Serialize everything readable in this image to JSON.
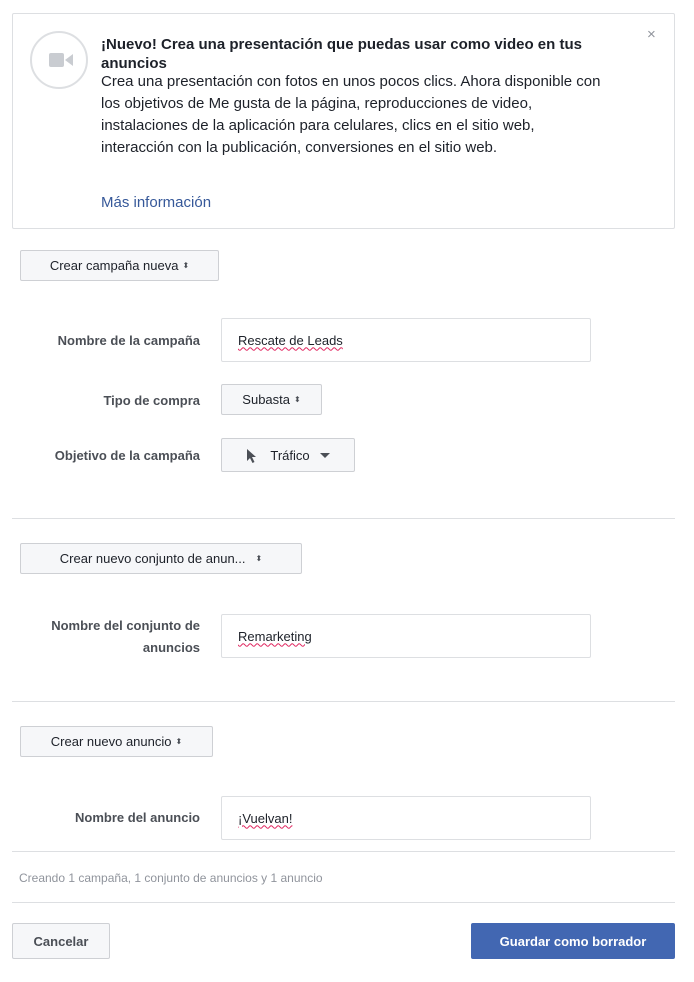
{
  "notice": {
    "icon": "video-camera-icon",
    "title": "¡Nuevo! Crea una presentación que puedas usar como video en tus anuncios",
    "body": "Crea una presentación con fotos en unos pocos clics. Ahora disponible con los objetivos de Me gusta de la página, reproducciones de video, instalaciones de la aplicación para celulares, clics en el sitio web, interacción con la publicación, conversiones en el sitio web.",
    "link": "Más información",
    "close": "×"
  },
  "campaign": {
    "create_selector": "Crear campaña nueva",
    "name_label": "Nombre de la campaña",
    "name_value": "Rescate de Leads",
    "buy_type_label": "Tipo de compra",
    "buy_type_value": "Subasta",
    "objective_label": "Objetivo de la campaña",
    "objective_value": "Tráfico",
    "objective_icon": "cursor-icon"
  },
  "adset": {
    "create_selector": "Crear nuevo conjunto de anun...",
    "name_label_line1": "Nombre del conjunto de",
    "name_label_line2": "anuncios",
    "name_value": "Remarketing"
  },
  "ad": {
    "create_selector": "Crear nuevo anuncio",
    "name_label": "Nombre del anuncio",
    "name_value": "¡Vuelvan!"
  },
  "summary": "Creando 1 campaña, 1 conjunto de anuncios y 1 anuncio",
  "footer": {
    "cancel": "Cancelar",
    "save_draft": "Guardar como borrador"
  },
  "colors": {
    "primary": "#4267b2",
    "link": "#365899",
    "border": "#dddfe2"
  }
}
